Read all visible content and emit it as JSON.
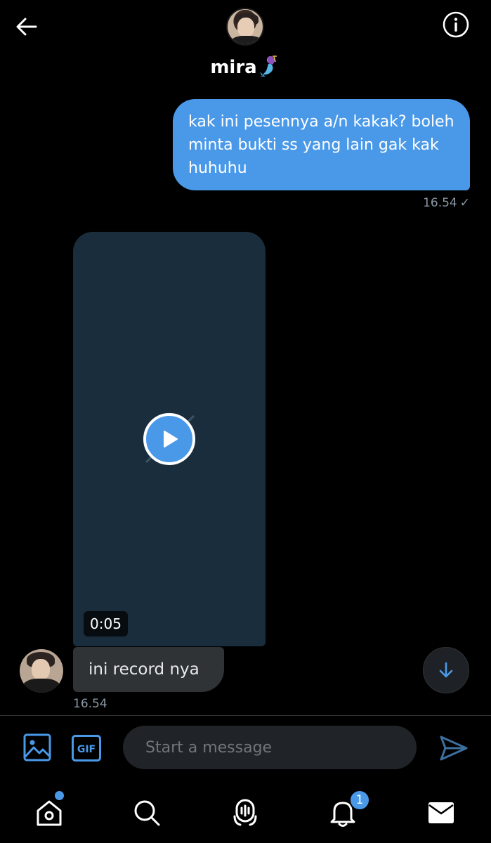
{
  "header": {
    "name": "mira",
    "name_emoji": "mermaid-emoji"
  },
  "messages": [
    {
      "direction": "outgoing",
      "text": "kak ini pesennya a/n kakak? boleh minta bukti ss yang lain gak kak huhuhu",
      "time": "16.54",
      "status": "✓"
    },
    {
      "direction": "incoming",
      "type": "video",
      "duration": "0:05"
    },
    {
      "direction": "incoming",
      "text": "ini record nya",
      "time": "16.54"
    }
  ],
  "composer": {
    "placeholder": "Start a message",
    "gif_label": "GIF"
  },
  "tabbar": {
    "notification_count": "1"
  },
  "colors": {
    "accent": "#4a99e9",
    "background": "#000000",
    "incoming_bubble": "#2f3336",
    "video_background": "#1a2d3c",
    "muted_text": "#8b98a5"
  }
}
